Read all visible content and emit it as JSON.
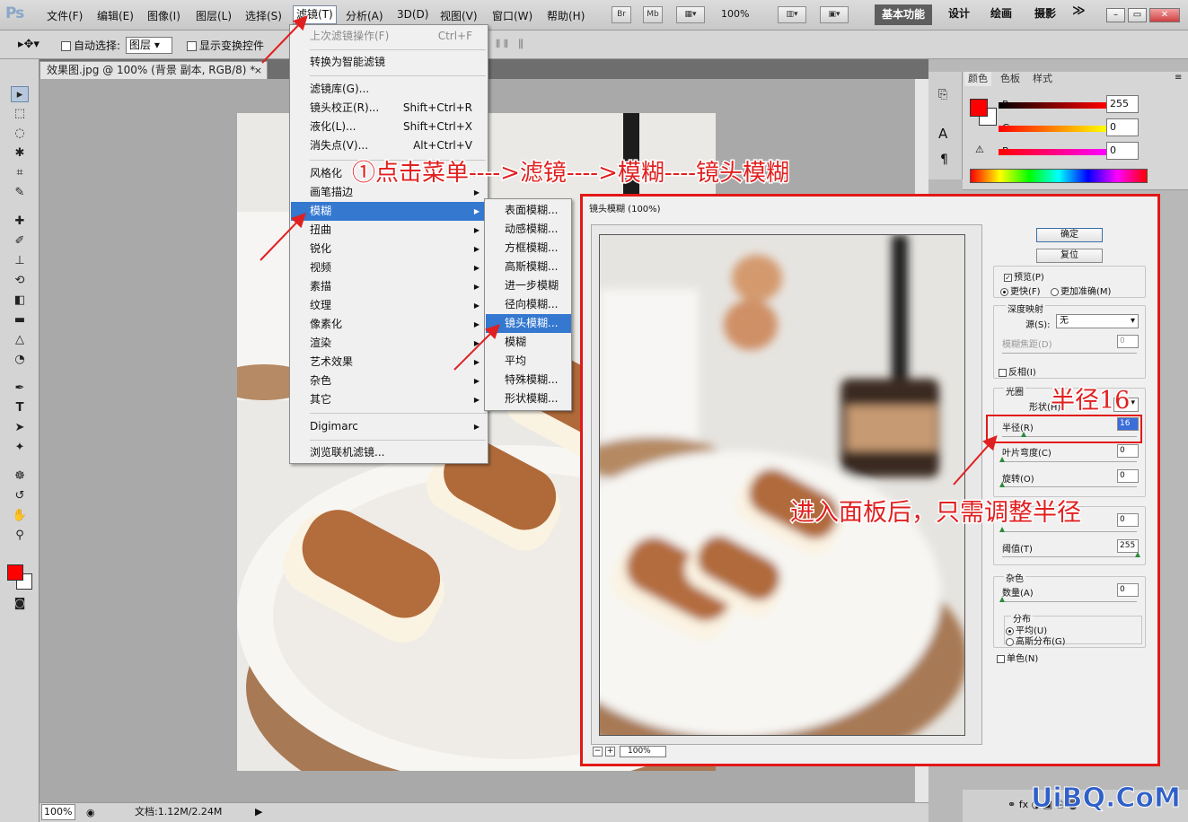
{
  "app": {
    "logo": "Ps"
  },
  "menubar": {
    "items": [
      "文件(F)",
      "编辑(E)",
      "图像(I)",
      "图层(L)",
      "选择(S)",
      "滤镜(T)",
      "分析(A)",
      "3D(D)",
      "视图(V)",
      "窗口(W)",
      "帮助(H)"
    ],
    "bridge": "Br",
    "minibridge": "Mb",
    "zoom": "100%",
    "workspaces": [
      "基本功能",
      "设计",
      "绘画",
      "摄影"
    ],
    "more": "≫"
  },
  "options": {
    "autoselect_label": "自动选择:",
    "autoselect_value": "图层",
    "show_transform": "显示变换控件"
  },
  "document": {
    "tab_title": "效果图.jpg @ 100% (背景 副本, RGB/8) *",
    "close": "×"
  },
  "status": {
    "zoom": "100%",
    "doc_info": "文档:1.12M/2.24M"
  },
  "color_panel": {
    "tabs": [
      "颜色",
      "色板",
      "样式"
    ],
    "r_label": "R",
    "g_label": "G",
    "b_label": "B",
    "r": "255",
    "g": "0",
    "b": "0",
    "foreground": "#ff0000",
    "background": "#ffffff"
  },
  "filter_menu": {
    "items": [
      {
        "label": "上次滤镜操作(F)",
        "shortcut": "Ctrl+F",
        "disabled": true
      },
      {
        "label": "转换为智能滤镜"
      },
      {
        "label": "滤镜库(G)..."
      },
      {
        "label": "镜头校正(R)...",
        "shortcut": "Shift+Ctrl+R"
      },
      {
        "label": "液化(L)...",
        "shortcut": "Shift+Ctrl+X"
      },
      {
        "label": "消失点(V)...",
        "shortcut": "Alt+Ctrl+V"
      },
      {
        "label": "风格化"
      },
      {
        "label": "画笔描边"
      },
      {
        "label": "模糊",
        "highlight": true
      },
      {
        "label": "扭曲"
      },
      {
        "label": "锐化"
      },
      {
        "label": "视频"
      },
      {
        "label": "素描"
      },
      {
        "label": "纹理"
      },
      {
        "label": "像素化"
      },
      {
        "label": "渲染"
      },
      {
        "label": "艺术效果"
      },
      {
        "label": "杂色"
      },
      {
        "label": "其它"
      },
      {
        "label": "Digimarc"
      },
      {
        "label": "浏览联机滤镜..."
      }
    ]
  },
  "blur_submenu": {
    "items": [
      "表面模糊...",
      "动感模糊...",
      "方框模糊...",
      "高斯模糊...",
      "进一步模糊",
      "径向模糊...",
      "镜头模糊...",
      "模糊",
      "平均",
      "特殊模糊...",
      "形状模糊..."
    ]
  },
  "lens_blur_dialog": {
    "title": "镜头模糊 (100%)",
    "ok": "确定",
    "reset": "复位",
    "preview": "预览(P)",
    "faster": "更快(F)",
    "more_accurate": "更加准确(M)",
    "depth_map": "深度映射",
    "source_label": "源(S):",
    "source_value": "无",
    "blur_focal": "模糊焦距(D)",
    "blur_focal_value": "0",
    "invert": "反相(I)",
    "iris": "光圈",
    "shape_label": "形状(H):",
    "radius_label": "半径(R)",
    "radius_value": "16",
    "blade_curvature": "叶片弯度(C)",
    "blade_value": "0",
    "rotation": "旋转(O)",
    "rotation_value": "0",
    "brightness_value": "0",
    "threshold": "阈值(T)",
    "threshold_value": "255",
    "noise": "杂色",
    "amount": "数量(A)",
    "amount_value": "0",
    "distribution": "分布",
    "uniform": "平均(U)",
    "gaussian": "高斯分布(G)",
    "monochromatic": "单色(N)",
    "zoom_value": "100%",
    "zoom_minus": "−",
    "zoom_plus": "+"
  },
  "annotations": {
    "step1": "①点击菜单---->滤镜---->模糊----镜头模糊",
    "radius": "半径16",
    "tip": "进入面板后，只需调整半径"
  },
  "watermark": "UiBQ.CoM"
}
